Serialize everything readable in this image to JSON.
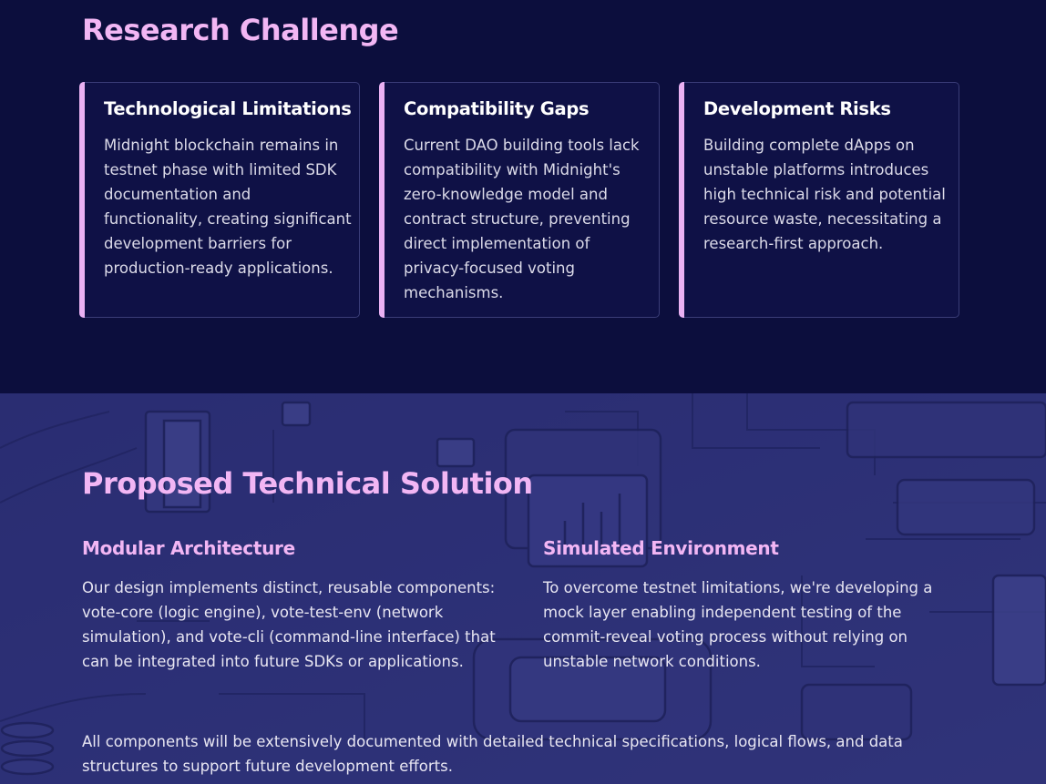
{
  "research": {
    "title": "Research Challenge",
    "cards": [
      {
        "title": "Technological Limitations",
        "text": "Midnight blockchain remains in testnet phase with limited SDK documentation and functionality, creating significant development barriers for production-ready applications."
      },
      {
        "title": "Compatibility Gaps",
        "text": "Current DAO building tools lack compatibility with Midnight's zero-knowledge model and contract structure, preventing direct implementation of privacy-focused voting mechanisms."
      },
      {
        "title": "Development Risks",
        "text": "Building complete dApps on unstable platforms introduces high technical risk and potential resource waste, necessitating a research-first approach."
      }
    ]
  },
  "solution": {
    "title": "Proposed Technical Solution",
    "columns": [
      {
        "title": "Modular Architecture",
        "text": "Our design implements distinct, reusable components: vote-core (logic engine), vote-test-env (network simulation), and vote-cli (command-line interface) that can be integrated into future SDKs or applications."
      },
      {
        "title": "Simulated Environment",
        "text": "To overcome testnet limitations, we're developing a mock layer enabling independent testing of the commit-reveal voting process without relying on unstable network conditions."
      }
    ],
    "footer": "All components will be extensively documented with detailed technical specifications, logical flows, and data structures to support future development efforts."
  },
  "colors": {
    "background_top": "#0c0e3d",
    "background_bottom": "#2c2f76",
    "accent": "#f2b6f4",
    "card_bar": "#eab1f3"
  }
}
